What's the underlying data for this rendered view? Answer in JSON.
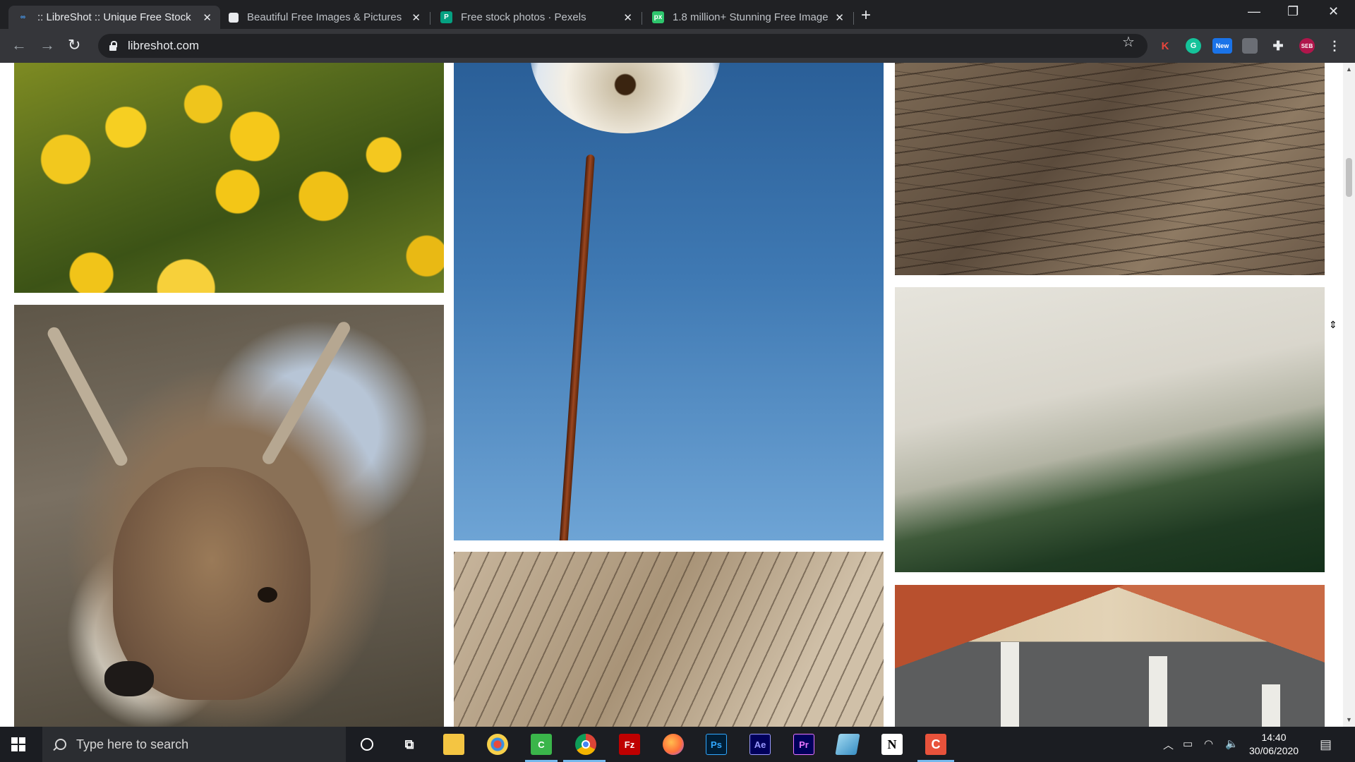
{
  "browser": {
    "tabs": [
      {
        "title": ":: LibreShot :: Unique Free Stock",
        "active": true,
        "favicon": "libreshot-icon"
      },
      {
        "title": "Beautiful Free Images & Pictures",
        "active": false,
        "favicon": "unsplash-icon"
      },
      {
        "title": "Free stock photos · Pexels",
        "active": false,
        "favicon": "pexels-icon",
        "favicon_text": "P"
      },
      {
        "title": "1.8 million+ Stunning Free Image",
        "active": false,
        "favicon": "pixabay-icon",
        "favicon_text": "px"
      }
    ],
    "close_glyph": "✕",
    "new_tab_glyph": "+",
    "window_controls": {
      "minimize": "—",
      "restore": "❐",
      "close": "✕"
    },
    "url": "libreshot.com",
    "extension_labels": {
      "k": "K",
      "g": "G",
      "new_badge": "New",
      "seb": "SEB"
    }
  },
  "gallery": {
    "images": [
      {
        "subject": "dandelion-field"
      },
      {
        "subject": "dandelion-puff"
      },
      {
        "subject": "tree-bark"
      },
      {
        "subject": "red-deer"
      },
      {
        "subject": "weathered-wood"
      },
      {
        "subject": "foggy-forest"
      },
      {
        "subject": "town-rooftops"
      }
    ]
  },
  "taskbar": {
    "search_placeholder": "Type here to search",
    "apps": [
      {
        "name": "cortana-icon"
      },
      {
        "name": "task-view-icon"
      },
      {
        "name": "file-explorer-icon"
      },
      {
        "name": "paint-icon"
      },
      {
        "name": "camtasia-icon"
      },
      {
        "name": "chrome-icon"
      },
      {
        "name": "filezilla-icon",
        "label": "Fz"
      },
      {
        "name": "firefox-icon"
      },
      {
        "name": "photoshop-icon",
        "label": "Ps"
      },
      {
        "name": "after-effects-icon",
        "label": "Ae"
      },
      {
        "name": "premiere-icon",
        "label": "Pr"
      },
      {
        "name": "app-icon"
      },
      {
        "name": "notion-icon",
        "label": "N"
      },
      {
        "name": "camtasia-recorder-icon",
        "label": "C"
      }
    ],
    "time": "14:40",
    "date": "30/06/2020"
  },
  "colors": {
    "chrome_bg": "#202124",
    "toolbar_bg": "#35363a",
    "taskbar_bg": "#1b1d22",
    "taskbar_accent": "#76b9ed"
  }
}
